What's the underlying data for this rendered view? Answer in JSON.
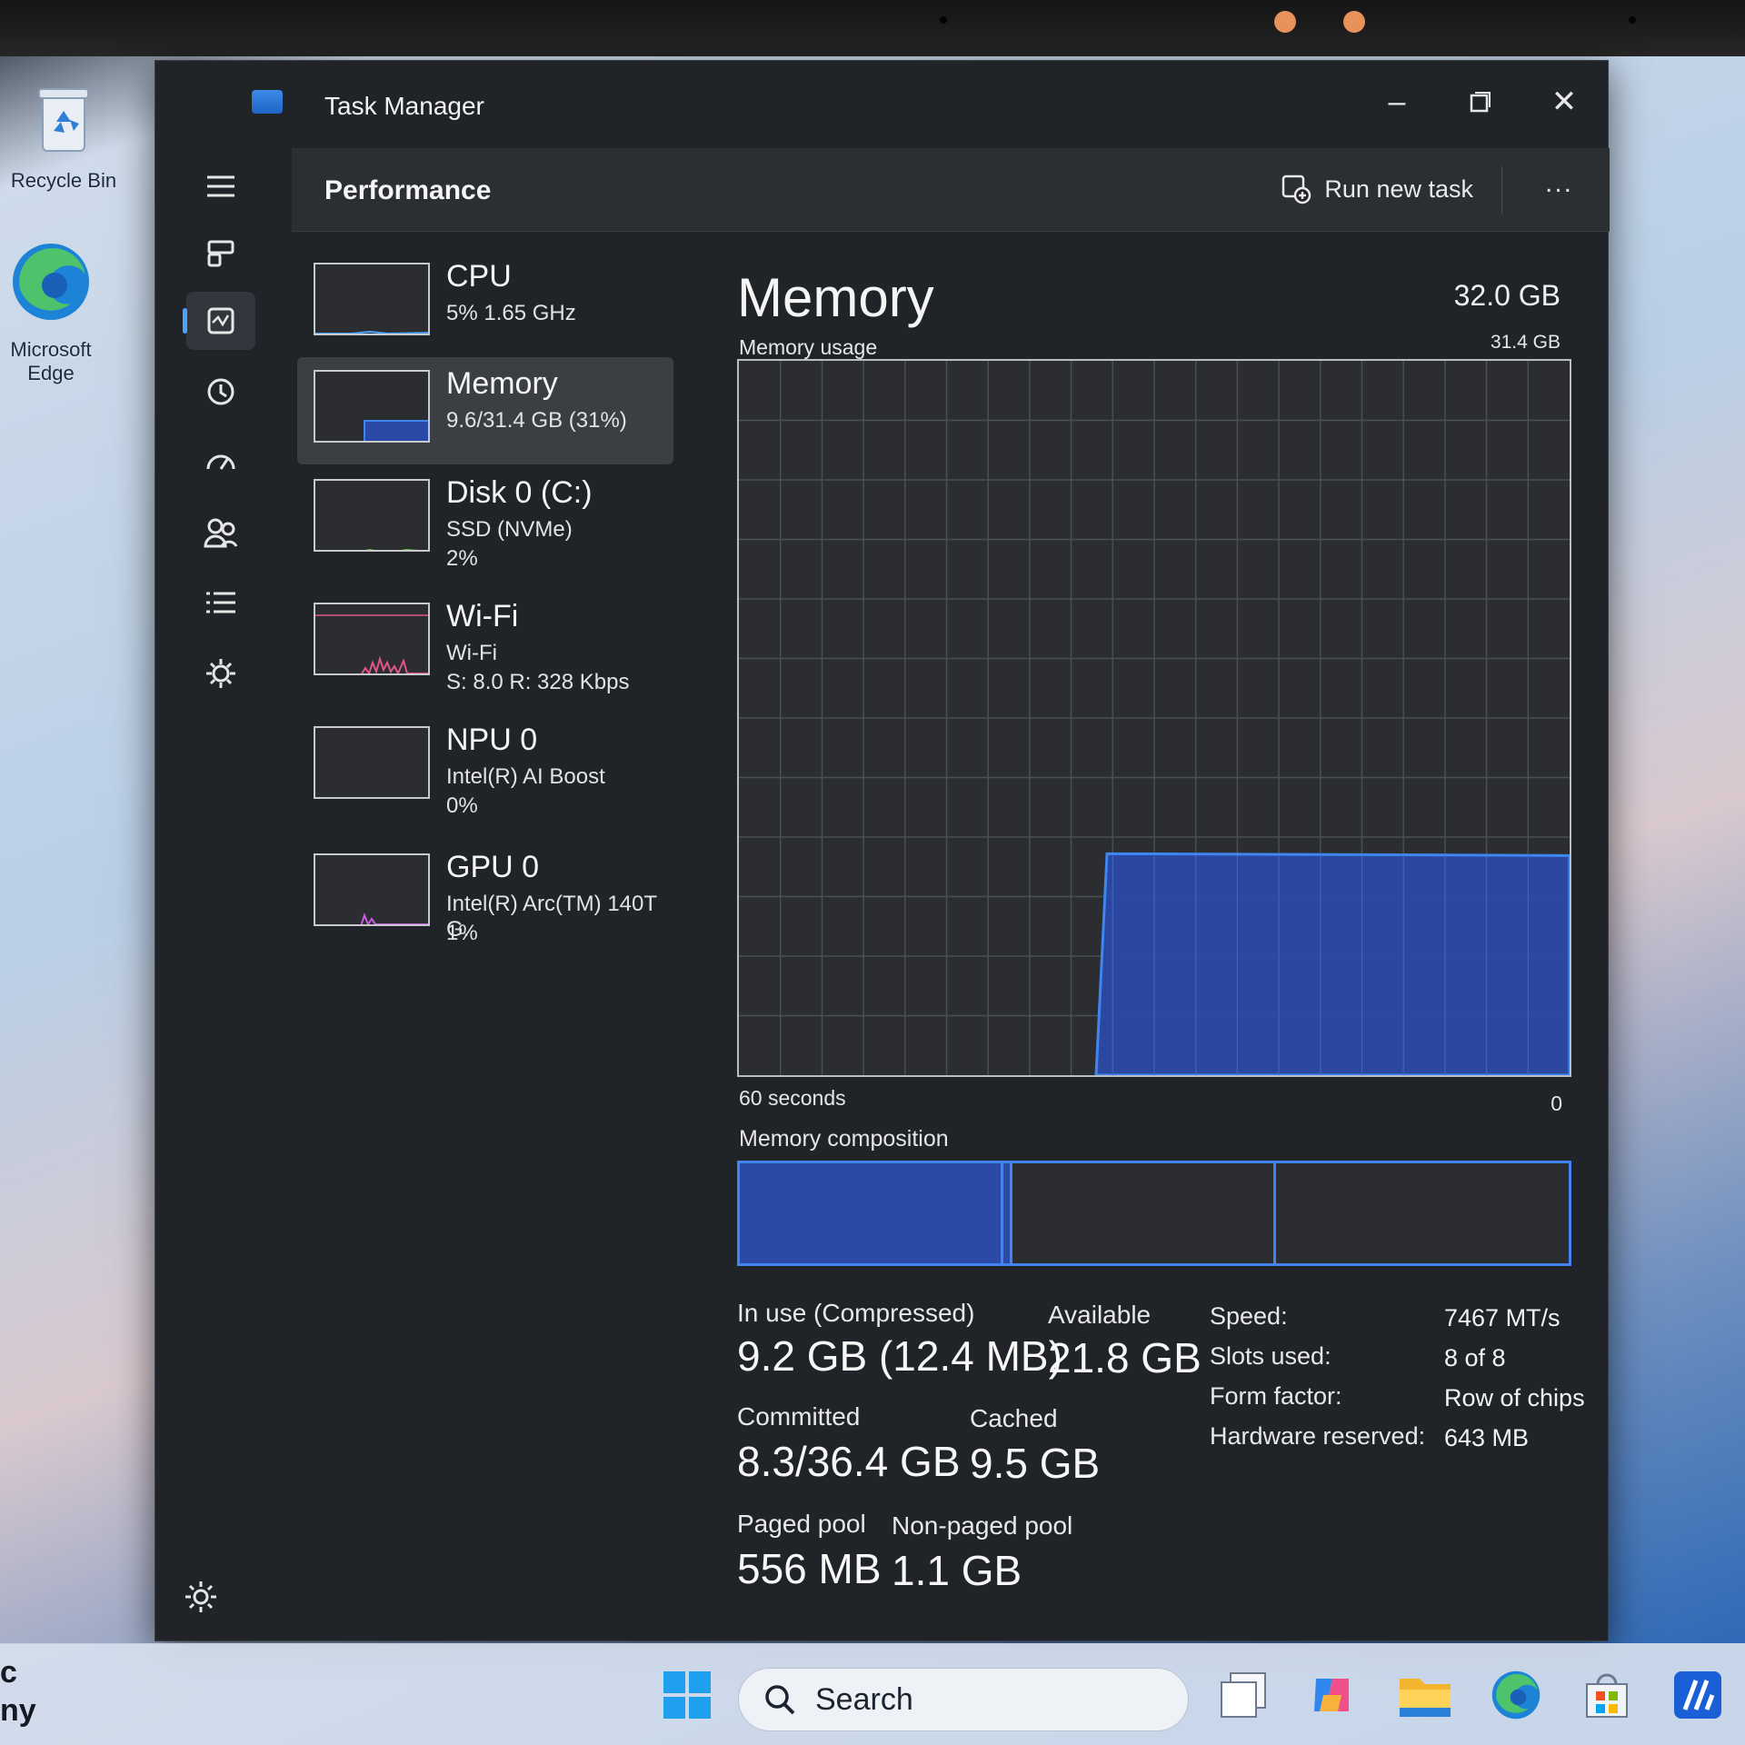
{
  "desktop": {
    "icons": [
      {
        "label": "Recycle Bin",
        "icon": "recycle-bin-icon"
      },
      {
        "label": "Microsoft Edge",
        "icon": "edge-icon"
      }
    ]
  },
  "window": {
    "title": "Task Manager",
    "controls": {
      "minimize": "minimize-icon",
      "maximize": "maximize-icon",
      "close": "close-icon"
    }
  },
  "header": {
    "page_title": "Performance",
    "run_new_task": "Run new task",
    "more": "..."
  },
  "nav": [
    {
      "icon": "hamburger-menu-icon"
    },
    {
      "icon": "processes-icon"
    },
    {
      "icon": "performance-icon",
      "active": true
    },
    {
      "icon": "app-history-icon"
    },
    {
      "icon": "startup-apps-icon"
    },
    {
      "icon": "users-icon"
    },
    {
      "icon": "details-icon"
    },
    {
      "icon": "services-icon"
    }
  ],
  "resources": [
    {
      "name": "CPU",
      "sub1": "5%  1.65 GHz",
      "sub2": "",
      "color": "#4aa3ff"
    },
    {
      "name": "Memory",
      "sub1": "9.6/31.4 GB (31%)",
      "sub2": "",
      "color": "#2b4aa8",
      "selected": true
    },
    {
      "name": "Disk 0 (C:)",
      "sub1": "SSD (NVMe)",
      "sub2": "2%",
      "color": "#5fbf3f"
    },
    {
      "name": "Wi-Fi",
      "sub1": "Wi-Fi",
      "sub2": "S: 8.0  R: 328 Kbps",
      "color": "#e0568a"
    },
    {
      "name": "NPU 0",
      "sub1": "Intel(R) AI Boost",
      "sub2": "0%",
      "color": "#8a7cf0"
    },
    {
      "name": "GPU 0",
      "sub1": "Intel(R) Arc(TM) 140T G.",
      "sub2": "1%",
      "color": "#c55fe0"
    }
  ],
  "memory": {
    "title": "Memory",
    "total": "32.0 GB",
    "usage_label": "Memory usage",
    "max_label": "31.4 GB",
    "axis_left": "60 seconds",
    "axis_right": "0",
    "composition_label": "Memory composition",
    "usage_fraction": 0.31,
    "fill_color": "#2b4aa8",
    "line_color": "#3f86f0",
    "stats": {
      "in_use_label": "In use (Compressed)",
      "in_use_value": "9.2 GB (12.4 MB)",
      "available_label": "Available",
      "available_value": "21.8 GB",
      "committed_label": "Committed",
      "committed_value": "8.3/36.4 GB",
      "cached_label": "Cached",
      "cached_value": "9.5 GB",
      "paged_label": "Paged pool",
      "paged_value": "556 MB",
      "nonpaged_label": "Non-paged pool",
      "nonpaged_value": "1.1 GB"
    },
    "specs": [
      {
        "key": "Speed:",
        "value": "7467 MT/s"
      },
      {
        "key": "Slots used:",
        "value": "8 of 8"
      },
      {
        "key": "Form factor:",
        "value": "Row of chips"
      },
      {
        "key": "Hardware reserved:",
        "value": "643 MB"
      }
    ]
  },
  "taskbar": {
    "left_text_1": "c",
    "left_text_2": "ny",
    "search_placeholder": "Search",
    "apps": [
      {
        "icon": "windows-start-icon"
      },
      {
        "icon": "task-view-icon"
      },
      {
        "icon": "copilot-icon"
      },
      {
        "icon": "file-explorer-icon"
      },
      {
        "icon": "edge-icon"
      },
      {
        "icon": "microsoft-store-icon"
      },
      {
        "icon": "intel-ai-icon"
      }
    ]
  }
}
